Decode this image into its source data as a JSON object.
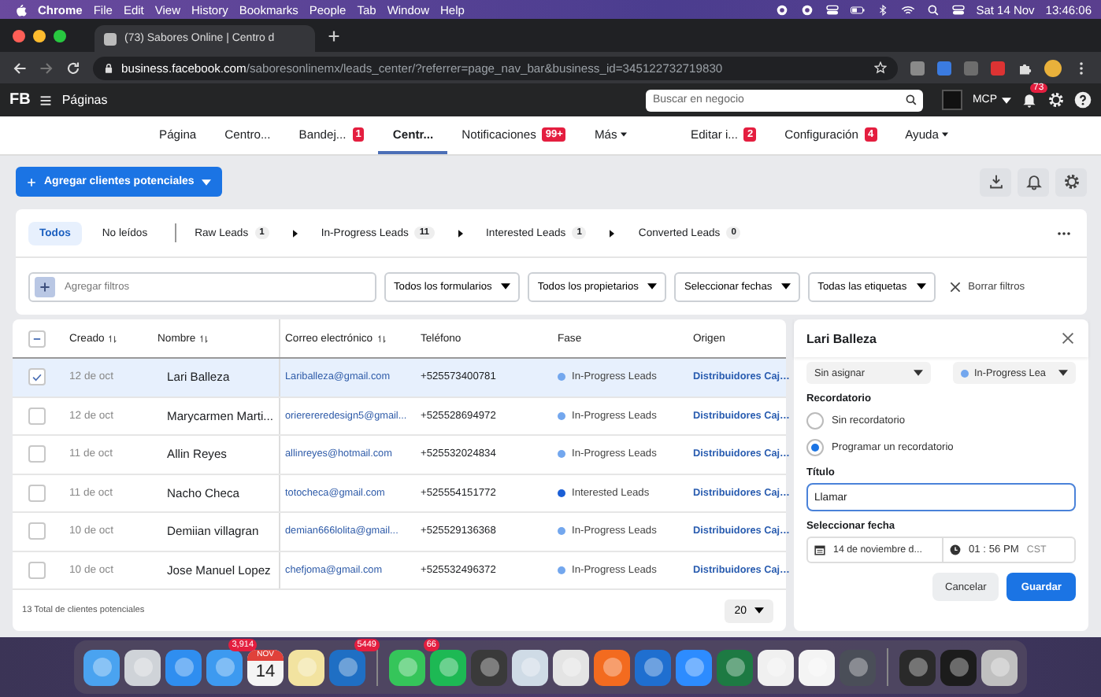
{
  "menu_bar": {
    "app": "Chrome",
    "menus": [
      "File",
      "Edit",
      "View",
      "History",
      "Bookmarks",
      "People",
      "Tab",
      "Window",
      "Help"
    ],
    "date": "Sat 14 Nov",
    "time": "13:46:06"
  },
  "browser": {
    "tab_title": "(73) Sabores Online | Centro d",
    "url_host": "business.facebook.com",
    "url_path": "/saboresonlinemx/leads_center/?referrer=page_nav_bar&business_id=345122732719830"
  },
  "fb_bar": {
    "logo": "FB",
    "section": "Páginas",
    "search_placeholder": "Buscar en negocio",
    "account": "MCP",
    "notification_count": "73"
  },
  "page_nav": {
    "left": [
      {
        "label": "Página",
        "selected": false
      },
      {
        "label": "Centro...",
        "selected": false
      },
      {
        "label": "Bandej...",
        "badge": "1",
        "selected": false
      },
      {
        "label": "Centr...",
        "selected": true
      },
      {
        "label": "Notificaciones",
        "badge": "99+",
        "selected": false
      },
      {
        "label": "Más",
        "dropdown": true,
        "selected": false
      }
    ],
    "right": [
      {
        "label": "Editar i...",
        "badge": "2",
        "selected": false
      },
      {
        "label": "Configuración",
        "badge": "4",
        "selected": false
      },
      {
        "label": "Ayuda",
        "dropdown": true,
        "selected": false
      }
    ]
  },
  "add_button": "Agregar clientes potenciales",
  "view_tabs": [
    {
      "label": "Todos",
      "selected": true
    },
    {
      "label": "No leídos",
      "selected": false
    }
  ],
  "stages": [
    {
      "label": "Raw Leads",
      "count": "1",
      "selected": false
    },
    {
      "label": "In-Progress Leads",
      "count": "11",
      "selected": false
    },
    {
      "label": "Interested Leads",
      "count": "1",
      "selected": false
    },
    {
      "label": "Converted Leads",
      "count": "0",
      "selected": false
    }
  ],
  "filters": {
    "placeholder": "Agregar filtros",
    "dropdowns": [
      "Todos los formularios",
      "Todos los propietarios",
      "Seleccionar fechas",
      "Todas las etiquetas"
    ],
    "clear": "Borrar filtros"
  },
  "table": {
    "select_all": {
      "indeterminate": true
    },
    "columns": [
      {
        "label": "Creado",
        "sortable": true
      },
      {
        "label": "Nombre",
        "sortable": true
      },
      {
        "label": "Correo electrónico",
        "sortable": true
      },
      {
        "label": "Teléfono",
        "sortable": false
      },
      {
        "label": "Fase",
        "sortable": false
      },
      {
        "label": "Origen",
        "sortable": false
      }
    ],
    "rows": [
      {
        "selected": true,
        "created": "12 de oct",
        "name": "Lari Balleza",
        "email": "Lariballeza@gmail.com",
        "phone": "+525573400781",
        "phase": "In-Progress Leads",
        "color": "#73a7ee",
        "origin": "Distribuidores Caj…"
      },
      {
        "selected": false,
        "created": "12 de oct",
        "name": "Marycarmen Marti...",
        "email": "orierereredesign5@gmail...",
        "phone": "+525528694972",
        "phase": "In-Progress Leads",
        "color": "#73a7ee",
        "origin": "Distribuidores Caj…"
      },
      {
        "selected": false,
        "created": "11 de oct",
        "name": "Allin Reyes",
        "email": "allinreyes@hotmail.com",
        "phone": "+525532024834",
        "phase": "In-Progress Leads",
        "color": "#73a7ee",
        "origin": "Distribuidores Caj…"
      },
      {
        "selected": false,
        "created": "11 de oct",
        "name": "Nacho Checa",
        "email": "totocheca@gmail.com",
        "phone": "+525554151772",
        "phase": "Interested Leads",
        "color": "#1b5fd6",
        "origin": "Distribuidores Caj…"
      },
      {
        "selected": false,
        "created": "10 de oct",
        "name": "Demiian villagran",
        "email": "demian666lolita@gmail...",
        "phone": "+525529136368",
        "phase": "In-Progress Leads",
        "color": "#73a7ee",
        "origin": "Distribuidores Caj…"
      },
      {
        "selected": false,
        "created": "10 de oct",
        "name": "Jose Manuel Lopez",
        "email": "chefjoma@gmail.com",
        "phone": "+525532496372",
        "phase": "In-Progress Leads",
        "color": "#73a7ee",
        "origin": "Distribuidores Caj…"
      }
    ],
    "total": "13 Total de clientes potenciales",
    "page_size": "20"
  },
  "detail_panel": {
    "title": "Lari Balleza",
    "owner": "Sin asignar",
    "stage": {
      "label": "In-Progress Lea",
      "color": "#73a7ee"
    },
    "reminder_label": "Recordatorio",
    "reminder_options": [
      {
        "label": "Sin recordatorio",
        "selected": false
      },
      {
        "label": "Programar un recordatorio",
        "selected": true
      }
    ],
    "title_label": "Título",
    "title_value": "Llamar",
    "date_label": "Seleccionar fecha",
    "date": "14 de noviembre d...",
    "time": "01 : 56 PM",
    "timezone": "CST",
    "buttons": [
      {
        "label": "Cancelar",
        "primary": false
      },
      {
        "label": "Guardar",
        "primary": true
      }
    ]
  },
  "dock": {
    "groups": [
      [
        {
          "kind": "app",
          "color": "#4aa3f0"
        },
        {
          "kind": "app",
          "color": "#cfd3d8"
        },
        {
          "kind": "app",
          "color": "#2f8ef0"
        },
        {
          "kind": "app",
          "color": "#3d9af0",
          "badge": "3,914"
        },
        {
          "kind": "calendar",
          "color": "#f4f4f4",
          "month": "NOV",
          "day": "14"
        },
        {
          "kind": "app",
          "color": "#f2e3a0"
        },
        {
          "kind": "app",
          "color": "#1f6fc4",
          "badge": "5449"
        }
      ],
      [
        {
          "kind": "app",
          "color": "#35c55a",
          "badge": "66"
        },
        {
          "kind": "app",
          "color": "#1db954"
        },
        {
          "kind": "app",
          "color": "#3a3a3a"
        },
        {
          "kind": "app",
          "color": "#cfdbe6"
        },
        {
          "kind": "app",
          "color": "#e4e4e4"
        },
        {
          "kind": "app",
          "color": "#f36b1f"
        },
        {
          "kind": "app",
          "color": "#1f6fd0"
        },
        {
          "kind": "app",
          "color": "#2d8cff"
        },
        {
          "kind": "app",
          "color": "#1d7a43"
        },
        {
          "kind": "app",
          "color": "#f0f0f0"
        },
        {
          "kind": "app",
          "color": "#f4f4f4"
        },
        {
          "kind": "app",
          "color": "#4a4e58"
        }
      ],
      [
        {
          "kind": "app",
          "color": "#2a2a2a"
        },
        {
          "kind": "app",
          "color": "#1c1c1c"
        },
        {
          "kind": "app",
          "color": "#c0c0c0"
        }
      ]
    ]
  }
}
